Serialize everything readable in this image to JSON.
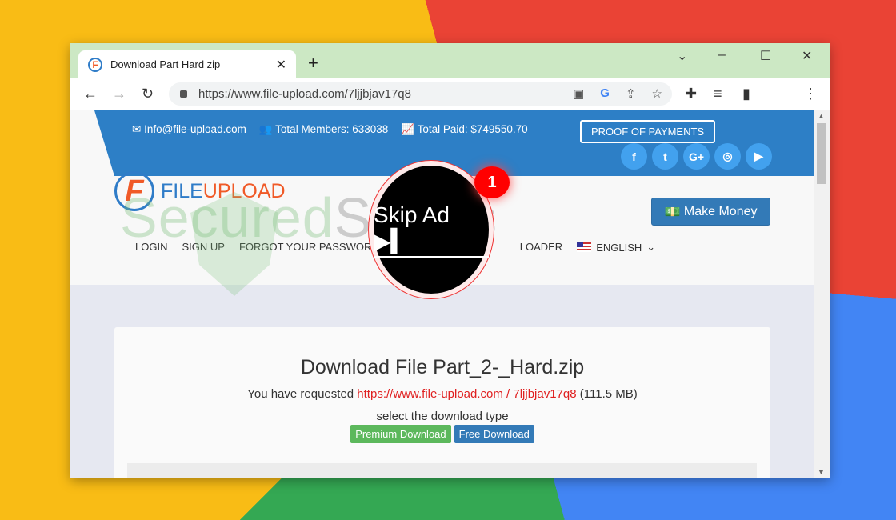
{
  "browser": {
    "tab_title": "Download Part Hard zip",
    "url": "https://www.file-upload.com/7ljjbjav17q8"
  },
  "topbar": {
    "email": "Info@file-upload.com",
    "members": "Total Members: 633038",
    "paid": "Total Paid: $749550.70",
    "proof": "PROOF OF PAYMENTS",
    "socials": [
      {
        "icon": "facebook-icon",
        "glyph": "f"
      },
      {
        "icon": "twitter-icon",
        "glyph": "t"
      },
      {
        "icon": "google-plus-icon",
        "glyph": "G+"
      },
      {
        "icon": "instagram-icon",
        "glyph": "◎"
      },
      {
        "icon": "youtube-icon",
        "glyph": "▶"
      }
    ]
  },
  "logo": {
    "part1": "FILE",
    "part2": "UPLOAD"
  },
  "make_money": "Make Money",
  "nav": [
    "LOGIN",
    "SIGN UP",
    "FORGOT YOUR PASSWORD",
    "LOADER",
    "ENGLISH"
  ],
  "main": {
    "title": "Download File Part_2-_Hard.zip",
    "requested_prefix": "You have requested",
    "link": "https://www.file-upload.com / 7ljjbjav17q8",
    "size": "(111.5 MB)",
    "select": "select the download type",
    "premium": "Premium Download",
    "free": "Free Download"
  },
  "overlay": {
    "skip": "Skip Ad ▶▍",
    "badge": "1"
  },
  "watermark": {
    "a": "Secured",
    "b": "Status"
  },
  "colors": {
    "brand_blue": "#2d7fc6",
    "brand_orange": "#f05a28",
    "link_red": "#e02020"
  }
}
